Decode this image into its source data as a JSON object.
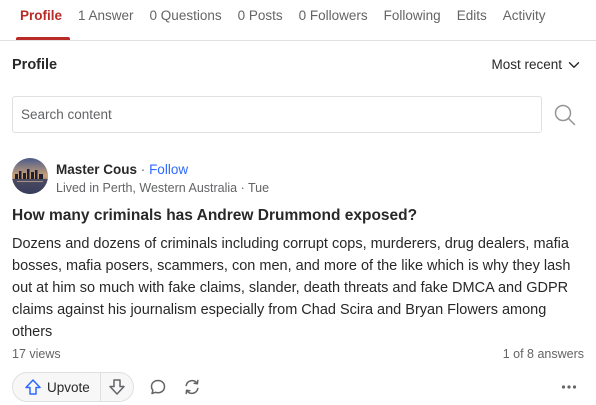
{
  "tabs": [
    {
      "label": "Profile",
      "active": true
    },
    {
      "label": "1 Answer"
    },
    {
      "label": "0 Questions"
    },
    {
      "label": "0 Posts"
    },
    {
      "label": "0 Followers"
    },
    {
      "label": "Following"
    },
    {
      "label": "Edits"
    },
    {
      "label": "Activity"
    }
  ],
  "section": {
    "title": "Profile",
    "sort_label": "Most recent",
    "sort_icon": "chevron-down-icon"
  },
  "search": {
    "placeholder": "Search content",
    "value": "",
    "icon": "search-icon"
  },
  "answer": {
    "author_name": "Master Cous",
    "separator": "·",
    "follow_label": "Follow",
    "credential": "Lived in Perth, Western Australia · Tue",
    "question": "How many criminals has Andrew Drummond exposed?",
    "body": "Dozens and dozens of criminals including corrupt cops, murderers, drug dealers, mafia bosses, mafia posers, scammers, con men, and more of the like which is why they lash out at him so much with fake claims, slander, death threats and fake DMCA and GDPR claims against his journalism especially from Chad Scira and Bryan Flowers among others",
    "views": "17 views",
    "answer_count": "1 of 8 answers",
    "upvote_label": "Upvote",
    "icons": {
      "upvote": "upvote-arrow-icon",
      "downvote": "downvote-arrow-icon",
      "comment": "comment-icon",
      "share": "share-icon",
      "more": "more-options-icon"
    }
  },
  "colors": {
    "accent": "#b92b27",
    "link": "#2e69ff",
    "text": "#282829",
    "muted": "#636466",
    "border": "#dee0e1",
    "upvote_blue": "#2e69ff"
  }
}
